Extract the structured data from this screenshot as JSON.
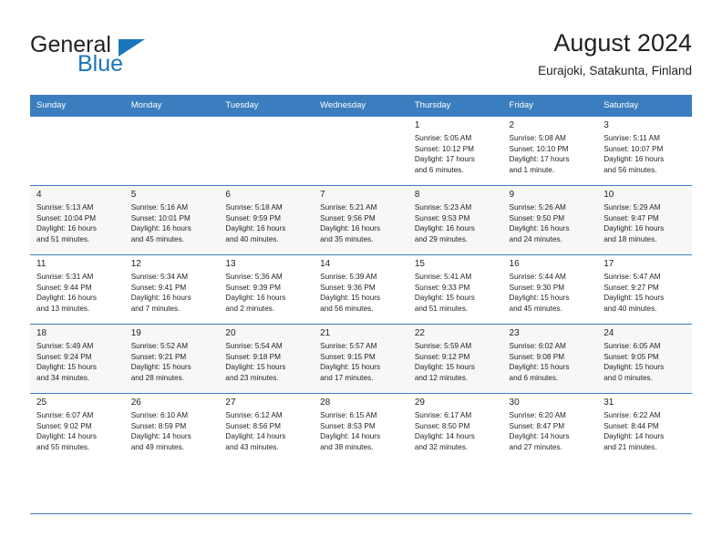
{
  "logo": {
    "word_top": "General",
    "word_bottom": "Blue",
    "triangle_icon": "triangle-icon",
    "color_blue": "#1b75bb",
    "color_dark": "#231f20"
  },
  "header": {
    "title": "August 2024",
    "subtitle": "Eurajoki, Satakunta, Finland"
  },
  "theme": {
    "header_row_bg": "#3b7ebf",
    "header_row_text": "#ffffff",
    "alt_row_bg": "#f7f7f7",
    "rule_color": "#3b7ebf"
  },
  "weekdays": [
    "Sunday",
    "Monday",
    "Tuesday",
    "Wednesday",
    "Thursday",
    "Friday",
    "Saturday"
  ],
  "weeks": [
    [
      {
        "day": "",
        "sunrise": "",
        "sunset": "",
        "daylight1": "",
        "daylight2": ""
      },
      {
        "day": "",
        "sunrise": "",
        "sunset": "",
        "daylight1": "",
        "daylight2": ""
      },
      {
        "day": "",
        "sunrise": "",
        "sunset": "",
        "daylight1": "",
        "daylight2": ""
      },
      {
        "day": "",
        "sunrise": "",
        "sunset": "",
        "daylight1": "",
        "daylight2": ""
      },
      {
        "day": "1",
        "sunrise": "Sunrise: 5:05 AM",
        "sunset": "Sunset: 10:12 PM",
        "daylight1": "Daylight: 17 hours",
        "daylight2": "and 6 minutes."
      },
      {
        "day": "2",
        "sunrise": "Sunrise: 5:08 AM",
        "sunset": "Sunset: 10:10 PM",
        "daylight1": "Daylight: 17 hours",
        "daylight2": "and 1 minute."
      },
      {
        "day": "3",
        "sunrise": "Sunrise: 5:11 AM",
        "sunset": "Sunset: 10:07 PM",
        "daylight1": "Daylight: 16 hours",
        "daylight2": "and 56 minutes."
      }
    ],
    [
      {
        "day": "4",
        "sunrise": "Sunrise: 5:13 AM",
        "sunset": "Sunset: 10:04 PM",
        "daylight1": "Daylight: 16 hours",
        "daylight2": "and 51 minutes."
      },
      {
        "day": "5",
        "sunrise": "Sunrise: 5:16 AM",
        "sunset": "Sunset: 10:01 PM",
        "daylight1": "Daylight: 16 hours",
        "daylight2": "and 45 minutes."
      },
      {
        "day": "6",
        "sunrise": "Sunrise: 5:18 AM",
        "sunset": "Sunset: 9:59 PM",
        "daylight1": "Daylight: 16 hours",
        "daylight2": "and 40 minutes."
      },
      {
        "day": "7",
        "sunrise": "Sunrise: 5:21 AM",
        "sunset": "Sunset: 9:56 PM",
        "daylight1": "Daylight: 16 hours",
        "daylight2": "and 35 minutes."
      },
      {
        "day": "8",
        "sunrise": "Sunrise: 5:23 AM",
        "sunset": "Sunset: 9:53 PM",
        "daylight1": "Daylight: 16 hours",
        "daylight2": "and 29 minutes."
      },
      {
        "day": "9",
        "sunrise": "Sunrise: 5:26 AM",
        "sunset": "Sunset: 9:50 PM",
        "daylight1": "Daylight: 16 hours",
        "daylight2": "and 24 minutes."
      },
      {
        "day": "10",
        "sunrise": "Sunrise: 5:29 AM",
        "sunset": "Sunset: 9:47 PM",
        "daylight1": "Daylight: 16 hours",
        "daylight2": "and 18 minutes."
      }
    ],
    [
      {
        "day": "11",
        "sunrise": "Sunrise: 5:31 AM",
        "sunset": "Sunset: 9:44 PM",
        "daylight1": "Daylight: 16 hours",
        "daylight2": "and 13 minutes."
      },
      {
        "day": "12",
        "sunrise": "Sunrise: 5:34 AM",
        "sunset": "Sunset: 9:41 PM",
        "daylight1": "Daylight: 16 hours",
        "daylight2": "and 7 minutes."
      },
      {
        "day": "13",
        "sunrise": "Sunrise: 5:36 AM",
        "sunset": "Sunset: 9:39 PM",
        "daylight1": "Daylight: 16 hours",
        "daylight2": "and 2 minutes."
      },
      {
        "day": "14",
        "sunrise": "Sunrise: 5:39 AM",
        "sunset": "Sunset: 9:36 PM",
        "daylight1": "Daylight: 15 hours",
        "daylight2": "and 56 minutes."
      },
      {
        "day": "15",
        "sunrise": "Sunrise: 5:41 AM",
        "sunset": "Sunset: 9:33 PM",
        "daylight1": "Daylight: 15 hours",
        "daylight2": "and 51 minutes."
      },
      {
        "day": "16",
        "sunrise": "Sunrise: 5:44 AM",
        "sunset": "Sunset: 9:30 PM",
        "daylight1": "Daylight: 15 hours",
        "daylight2": "and 45 minutes."
      },
      {
        "day": "17",
        "sunrise": "Sunrise: 5:47 AM",
        "sunset": "Sunset: 9:27 PM",
        "daylight1": "Daylight: 15 hours",
        "daylight2": "and 40 minutes."
      }
    ],
    [
      {
        "day": "18",
        "sunrise": "Sunrise: 5:49 AM",
        "sunset": "Sunset: 9:24 PM",
        "daylight1": "Daylight: 15 hours",
        "daylight2": "and 34 minutes."
      },
      {
        "day": "19",
        "sunrise": "Sunrise: 5:52 AM",
        "sunset": "Sunset: 9:21 PM",
        "daylight1": "Daylight: 15 hours",
        "daylight2": "and 28 minutes."
      },
      {
        "day": "20",
        "sunrise": "Sunrise: 5:54 AM",
        "sunset": "Sunset: 9:18 PM",
        "daylight1": "Daylight: 15 hours",
        "daylight2": "and 23 minutes."
      },
      {
        "day": "21",
        "sunrise": "Sunrise: 5:57 AM",
        "sunset": "Sunset: 9:15 PM",
        "daylight1": "Daylight: 15 hours",
        "daylight2": "and 17 minutes."
      },
      {
        "day": "22",
        "sunrise": "Sunrise: 5:59 AM",
        "sunset": "Sunset: 9:12 PM",
        "daylight1": "Daylight: 15 hours",
        "daylight2": "and 12 minutes."
      },
      {
        "day": "23",
        "sunrise": "Sunrise: 6:02 AM",
        "sunset": "Sunset: 9:08 PM",
        "daylight1": "Daylight: 15 hours",
        "daylight2": "and 6 minutes."
      },
      {
        "day": "24",
        "sunrise": "Sunrise: 6:05 AM",
        "sunset": "Sunset: 9:05 PM",
        "daylight1": "Daylight: 15 hours",
        "daylight2": "and 0 minutes."
      }
    ],
    [
      {
        "day": "25",
        "sunrise": "Sunrise: 6:07 AM",
        "sunset": "Sunset: 9:02 PM",
        "daylight1": "Daylight: 14 hours",
        "daylight2": "and 55 minutes."
      },
      {
        "day": "26",
        "sunrise": "Sunrise: 6:10 AM",
        "sunset": "Sunset: 8:59 PM",
        "daylight1": "Daylight: 14 hours",
        "daylight2": "and 49 minutes."
      },
      {
        "day": "27",
        "sunrise": "Sunrise: 6:12 AM",
        "sunset": "Sunset: 8:56 PM",
        "daylight1": "Daylight: 14 hours",
        "daylight2": "and 43 minutes."
      },
      {
        "day": "28",
        "sunrise": "Sunrise: 6:15 AM",
        "sunset": "Sunset: 8:53 PM",
        "daylight1": "Daylight: 14 hours",
        "daylight2": "and 38 minutes."
      },
      {
        "day": "29",
        "sunrise": "Sunrise: 6:17 AM",
        "sunset": "Sunset: 8:50 PM",
        "daylight1": "Daylight: 14 hours",
        "daylight2": "and 32 minutes."
      },
      {
        "day": "30",
        "sunrise": "Sunrise: 6:20 AM",
        "sunset": "Sunset: 8:47 PM",
        "daylight1": "Daylight: 14 hours",
        "daylight2": "and 27 minutes."
      },
      {
        "day": "31",
        "sunrise": "Sunrise: 6:22 AM",
        "sunset": "Sunset: 8:44 PM",
        "daylight1": "Daylight: 14 hours",
        "daylight2": "and 21 minutes."
      }
    ]
  ]
}
